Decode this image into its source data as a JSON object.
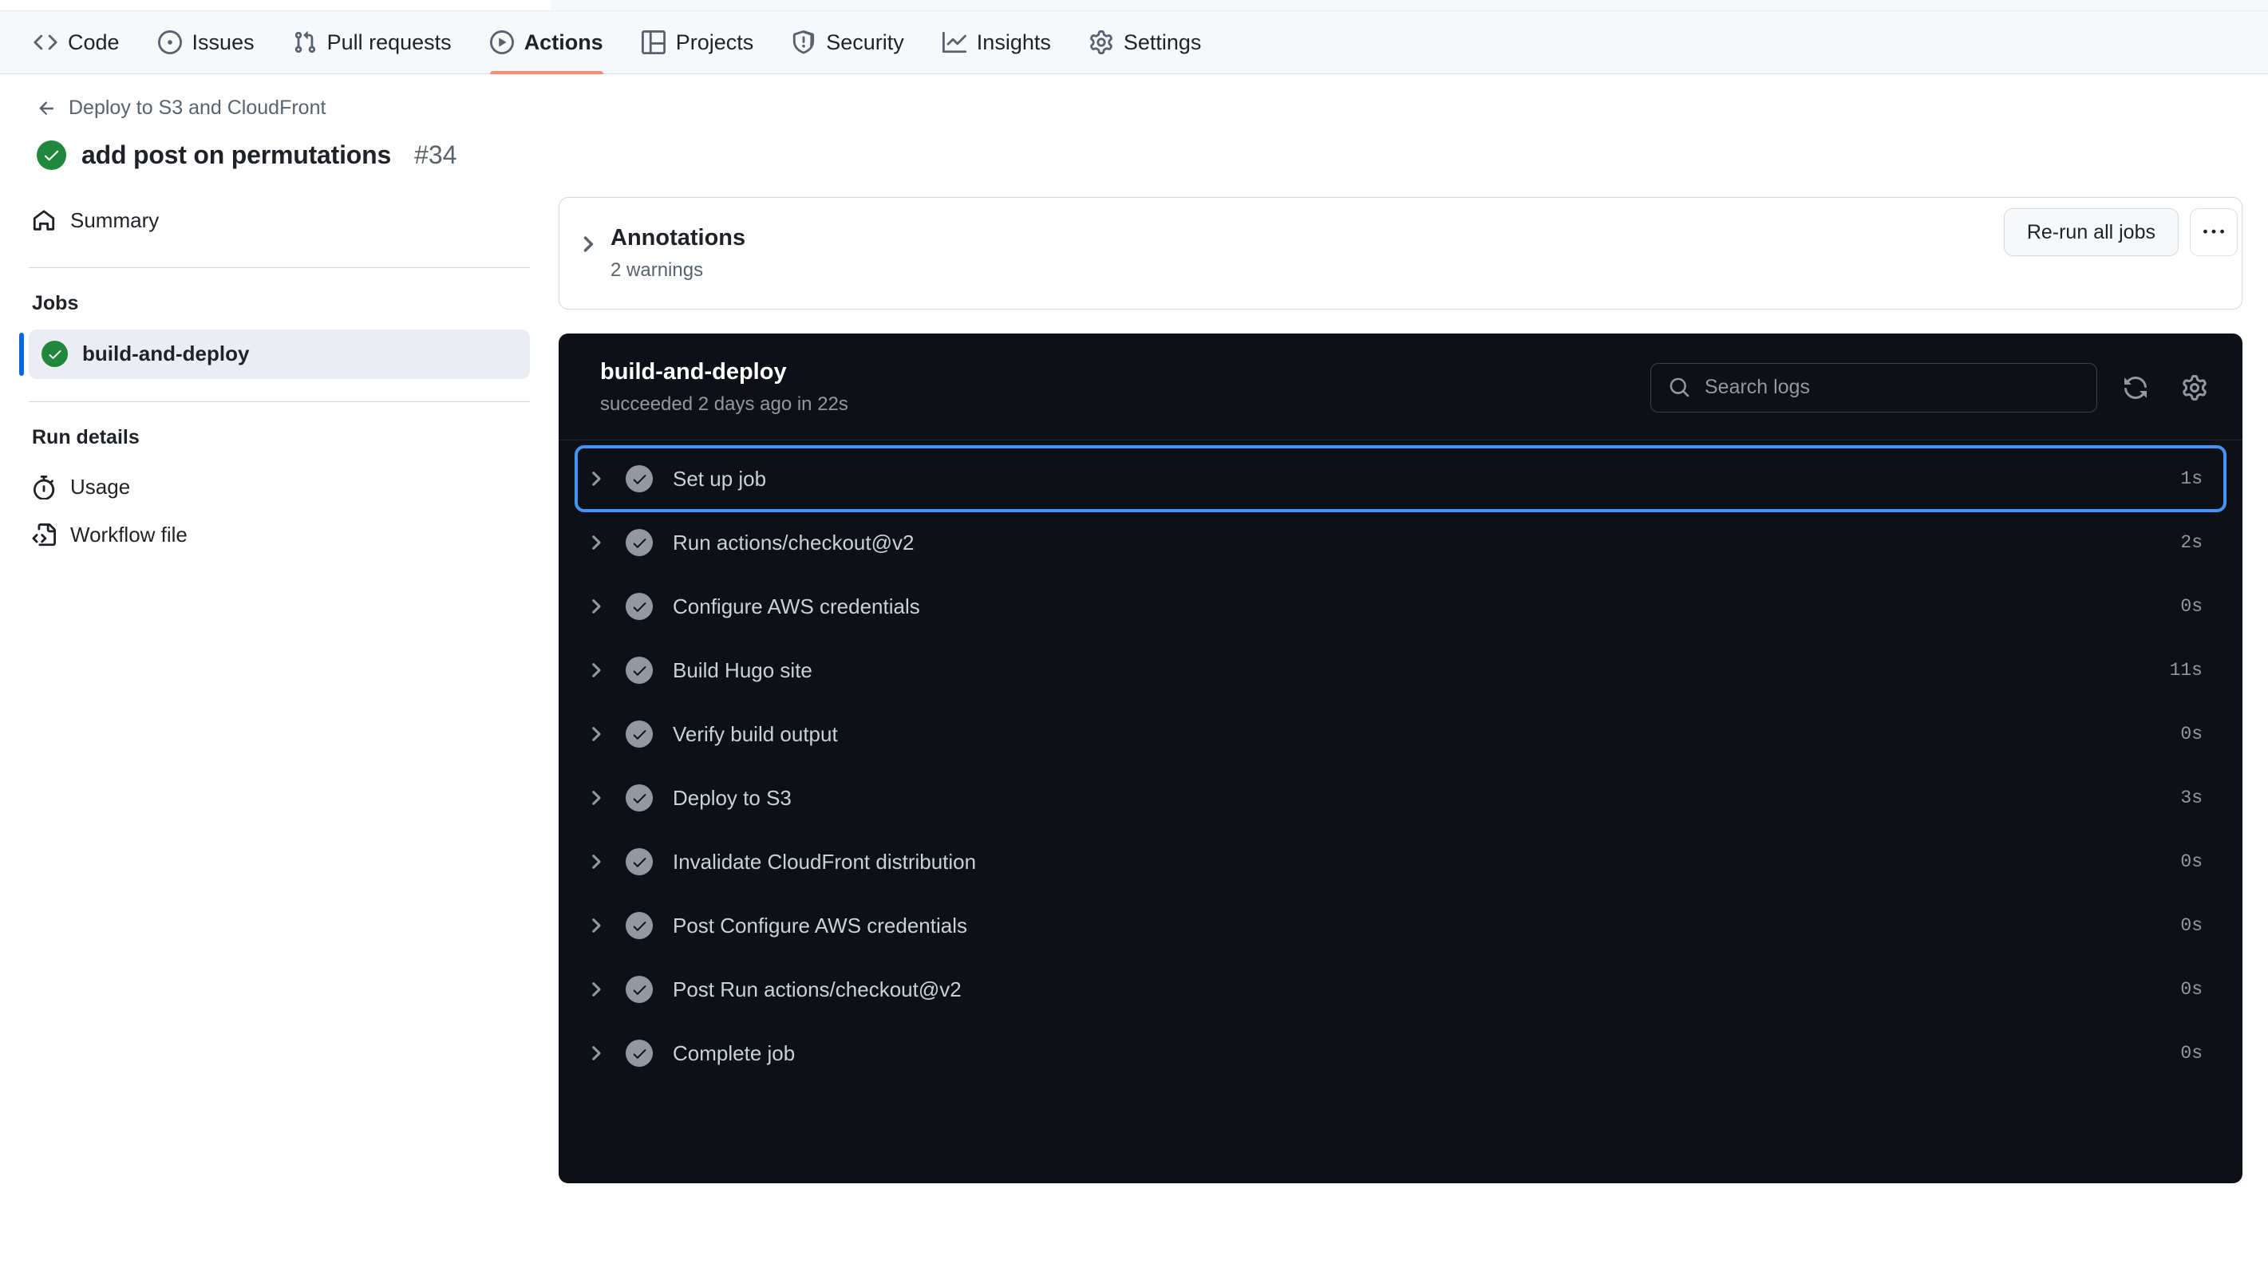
{
  "repo_nav": {
    "items": [
      {
        "label": "Code",
        "icon": "code-icon",
        "active": false
      },
      {
        "label": "Issues",
        "icon": "issue-opened-icon",
        "active": false
      },
      {
        "label": "Pull requests",
        "icon": "git-pull-request-icon",
        "active": false
      },
      {
        "label": "Actions",
        "icon": "play-icon",
        "active": true
      },
      {
        "label": "Projects",
        "icon": "table-icon",
        "active": false
      },
      {
        "label": "Security",
        "icon": "shield-icon",
        "active": false
      },
      {
        "label": "Insights",
        "icon": "graph-icon",
        "active": false
      },
      {
        "label": "Settings",
        "icon": "gear-icon",
        "active": false
      }
    ]
  },
  "header": {
    "breadcrumb": "Deploy to S3 and CloudFront",
    "back_icon": "arrow-left-icon",
    "status_icon": "check-circle-icon",
    "status_color": "#1f883d",
    "run_title": "add post on permutations",
    "run_number": "#34",
    "rerun_label": "Re-run all jobs",
    "more_label": "···"
  },
  "sidebar": {
    "summary": {
      "label": "Summary",
      "icon": "home-icon"
    },
    "jobs_title": "Jobs",
    "jobs": [
      {
        "label": "build-and-deploy",
        "status": "success",
        "selected": true,
        "icon": "check-circle-icon"
      }
    ],
    "run_details_title": "Run details",
    "run_details": [
      {
        "label": "Usage",
        "icon": "stopwatch-icon"
      },
      {
        "label": "Workflow file",
        "icon": "file-code-icon"
      }
    ]
  },
  "annotations": {
    "chevron_icon": "chevron-right-icon",
    "title": "Annotations",
    "subtitle": "2 warnings"
  },
  "log_panel": {
    "job_name": "build-and-deploy",
    "job_status_text": "succeeded 2 days ago in 22s",
    "search": {
      "placeholder": "Search logs",
      "value": "",
      "icon": "search-icon"
    },
    "refresh_icon": "sync-icon",
    "settings_icon": "gear-icon",
    "steps": [
      {
        "name": "Set up job",
        "duration": "1s",
        "status": "success",
        "focused": true
      },
      {
        "name": "Run actions/checkout@v2",
        "duration": "2s",
        "status": "success",
        "focused": false
      },
      {
        "name": "Configure AWS credentials",
        "duration": "0s",
        "status": "success",
        "focused": false
      },
      {
        "name": "Build Hugo site",
        "duration": "11s",
        "status": "success",
        "focused": false
      },
      {
        "name": "Verify build output",
        "duration": "0s",
        "status": "success",
        "focused": false
      },
      {
        "name": "Deploy to S3",
        "duration": "3s",
        "status": "success",
        "focused": false
      },
      {
        "name": "Invalidate CloudFront distribution",
        "duration": "0s",
        "status": "success",
        "focused": false
      },
      {
        "name": "Post Configure AWS credentials",
        "duration": "0s",
        "status": "success",
        "focused": false
      },
      {
        "name": "Post Run actions/checkout@v2",
        "duration": "0s",
        "status": "success",
        "focused": false
      },
      {
        "name": "Complete job",
        "duration": "0s",
        "status": "success",
        "focused": false
      }
    ]
  },
  "colors": {
    "accent_blue": "#0969da",
    "focus_blue": "#4493f8",
    "success_green": "#1f883d",
    "tab_underline": "#fd8c73",
    "panel_bg": "#0d1117"
  }
}
